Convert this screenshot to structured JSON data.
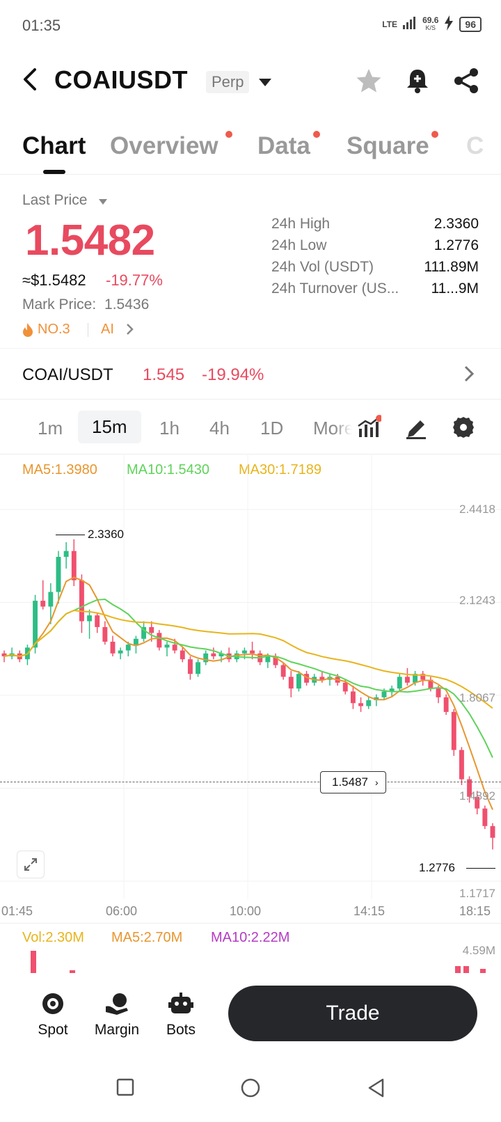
{
  "status": {
    "time": "01:35",
    "network": "LTE",
    "speed": "69.6",
    "speed_unit": "K/S",
    "battery": "96"
  },
  "header": {
    "symbol": "COAIUSDT",
    "contract_type": "Perp"
  },
  "tabs": [
    {
      "label": "Chart",
      "active": true,
      "dot": false
    },
    {
      "label": "Overview",
      "active": false,
      "dot": true
    },
    {
      "label": "Data",
      "active": false,
      "dot": true
    },
    {
      "label": "Square",
      "active": false,
      "dot": true
    }
  ],
  "price": {
    "last_label": "Last Price",
    "last": "1.5482",
    "usd": "≈$1.5482",
    "change": "-19.77%",
    "mark_label": "Mark Price:",
    "mark_value": "1.5436",
    "rank": "NO.3",
    "ai": "AI"
  },
  "stats": [
    {
      "label": "24h High",
      "value": "2.3360"
    },
    {
      "label": "24h Low",
      "value": "1.2776"
    },
    {
      "label": "24h Vol (USDT)",
      "value": "111.89M"
    },
    {
      "label": "24h Turnover (US...",
      "value": "11...9M"
    }
  ],
  "spot_pair": {
    "label": "COAI/USDT",
    "price": "1.545",
    "change": "-19.94%"
  },
  "intervals": [
    "1m",
    "15m",
    "1h",
    "4h",
    "1D",
    "More"
  ],
  "active_interval": "15m",
  "ma": {
    "ma5": "MA5:1.3980",
    "ma10": "MA10:1.5430",
    "ma30": "MA30:1.7189"
  },
  "colors": {
    "up": "#2ebd85",
    "down": "#f0506e",
    "ma5": "#e8962e",
    "ma10": "#5fd35a",
    "ma30": "#e8b41c",
    "vol_ma10": "#b43bc4"
  },
  "chart_data": {
    "type": "candlestick",
    "y_axis_ticks": [
      "2.4418",
      "2.1243",
      "1.8067",
      "1.4892",
      "1.1717"
    ],
    "x_axis_ticks": [
      "01:45",
      "06:00",
      "10:00",
      "14:15",
      "18:15"
    ],
    "high_marker": "2.3360",
    "low_marker": "1.2776",
    "current_marker": "1.5487",
    "ylim": [
      1.1717,
      2.4418
    ],
    "candles": [
      [
        1.95,
        1.96,
        1.92,
        1.94
      ],
      [
        1.94,
        1.97,
        1.93,
        1.95
      ],
      [
        1.95,
        1.96,
        1.92,
        1.93
      ],
      [
        1.93,
        1.98,
        1.91,
        1.97
      ],
      [
        1.97,
        2.15,
        1.95,
        2.13
      ],
      [
        2.13,
        2.2,
        2.1,
        2.11
      ],
      [
        2.11,
        2.19,
        2.05,
        2.16
      ],
      [
        2.16,
        2.3,
        2.12,
        2.28
      ],
      [
        2.28,
        2.33,
        2.24,
        2.3
      ],
      [
        2.3,
        2.34,
        2.18,
        2.2
      ],
      [
        2.2,
        2.22,
        2.02,
        2.06
      ],
      [
        2.06,
        2.1,
        2.0,
        2.08
      ],
      [
        2.08,
        2.09,
        2.02,
        2.04
      ],
      [
        2.04,
        2.06,
        1.98,
        1.99
      ],
      [
        1.99,
        2.01,
        1.94,
        1.95
      ],
      [
        1.95,
        1.97,
        1.93,
        1.96
      ],
      [
        1.96,
        1.99,
        1.94,
        1.98
      ],
      [
        1.98,
        2.01,
        1.95,
        2.0
      ],
      [
        2.0,
        2.06,
        1.99,
        2.04
      ],
      [
        2.04,
        2.06,
        1.99,
        2.02
      ],
      [
        2.02,
        2.03,
        1.96,
        1.97
      ],
      [
        1.97,
        1.99,
        1.94,
        1.98
      ],
      [
        1.98,
        2.0,
        1.95,
        1.96
      ],
      [
        1.96,
        1.97,
        1.92,
        1.93
      ],
      [
        1.93,
        1.94,
        1.86,
        1.88
      ],
      [
        1.88,
        1.93,
        1.87,
        1.92
      ],
      [
        1.92,
        1.96,
        1.91,
        1.95
      ],
      [
        1.95,
        1.97,
        1.93,
        1.94
      ],
      [
        1.94,
        1.96,
        1.92,
        1.95
      ],
      [
        1.95,
        1.97,
        1.92,
        1.93
      ],
      [
        1.93,
        1.96,
        1.92,
        1.95
      ],
      [
        1.95,
        1.97,
        1.93,
        1.96
      ],
      [
        1.96,
        1.99,
        1.93,
        1.95
      ],
      [
        1.95,
        1.96,
        1.91,
        1.92
      ],
      [
        1.92,
        1.95,
        1.9,
        1.94
      ],
      [
        1.94,
        1.95,
        1.9,
        1.91
      ],
      [
        1.91,
        1.92,
        1.86,
        1.87
      ],
      [
        1.87,
        1.89,
        1.8,
        1.83
      ],
      [
        1.83,
        1.89,
        1.82,
        1.88
      ],
      [
        1.88,
        1.89,
        1.84,
        1.85
      ],
      [
        1.85,
        1.88,
        1.84,
        1.87
      ],
      [
        1.87,
        1.89,
        1.85,
        1.86
      ],
      [
        1.86,
        1.88,
        1.84,
        1.87
      ],
      [
        1.87,
        1.88,
        1.84,
        1.85
      ],
      [
        1.85,
        1.86,
        1.81,
        1.82
      ],
      [
        1.82,
        1.84,
        1.76,
        1.78
      ],
      [
        1.78,
        1.8,
        1.75,
        1.77
      ],
      [
        1.77,
        1.8,
        1.76,
        1.79
      ],
      [
        1.79,
        1.81,
        1.77,
        1.8
      ],
      [
        1.8,
        1.83,
        1.79,
        1.82
      ],
      [
        1.82,
        1.84,
        1.8,
        1.83
      ],
      [
        1.83,
        1.88,
        1.82,
        1.87
      ],
      [
        1.87,
        1.9,
        1.84,
        1.85
      ],
      [
        1.85,
        1.89,
        1.84,
        1.88
      ],
      [
        1.88,
        1.89,
        1.84,
        1.86
      ],
      [
        1.86,
        1.87,
        1.82,
        1.83
      ],
      [
        1.83,
        1.84,
        1.78,
        1.8
      ],
      [
        1.8,
        1.81,
        1.74,
        1.75
      ],
      [
        1.75,
        1.76,
        1.6,
        1.62
      ],
      [
        1.62,
        1.63,
        1.5,
        1.52
      ],
      [
        1.52,
        1.53,
        1.44,
        1.46
      ],
      [
        1.46,
        1.48,
        1.4,
        1.42
      ],
      [
        1.42,
        1.43,
        1.35,
        1.36
      ],
      [
        1.36,
        1.37,
        1.28,
        1.32
      ]
    ],
    "volume": {
      "label": "Vol:2.30M",
      "ma5": "MA5:2.70M",
      "ma10": "MA10:2.22M",
      "axis_max": "4.59M"
    }
  },
  "bottom_nav": [
    {
      "label": "Spot"
    },
    {
      "label": "Margin"
    },
    {
      "label": "Bots"
    }
  ],
  "trade_button": "Trade"
}
